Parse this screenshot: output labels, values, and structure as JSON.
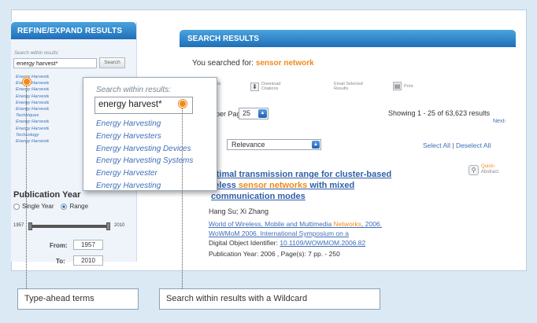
{
  "left_panel": {
    "header": "REFINE/EXPAND RESULTS",
    "search_label": "Search within results:",
    "search_value": "energy harvest*",
    "search_button": "Search",
    "list_items": [
      "Energy Harvesting",
      "Energy Harvesters",
      "Energy Harvesting",
      "Energy Harvesting",
      "Energy Harvesting",
      "Energy Harvesting",
      "Techniques",
      "Energy Harvesting",
      "Energy Harvesting",
      "Technology",
      "Energy Harvesting"
    ],
    "pub_year_title": "Publication Year",
    "radio_single": "Single Year",
    "radio_range": "Range",
    "slider_min": "1957",
    "slider_max": "2010",
    "from_label": "From:",
    "from_value": "1957",
    "to_label": "To:",
    "to_value": "2010"
  },
  "right_panel": {
    "header": "SEARCH RESULTS",
    "searched_prefix": "You searched for:",
    "searched_term": "sensor network",
    "tools": [
      {
        "icon": "email-icon",
        "line1": "This",
        "line2": "ch"
      },
      {
        "icon": "download-icon",
        "line1": "Download",
        "line2": "Citations"
      },
      {
        "icon": "email-selected-icon",
        "line1": "Email Selected",
        "line2": "Results"
      },
      {
        "icon": "print-icon",
        "line1": "Print",
        "line2": ""
      }
    ],
    "per_page_label": "per Page",
    "per_page_value": "25",
    "showing": "Showing 1 - 25 of 63,623 results",
    "next": "Next",
    "sort_value": "Relevance",
    "select_all": "Select All",
    "deselect_all": "Deselect All",
    "result": {
      "title_part1": "ptimal transmission range for cluster-based",
      "title_part2_pre": "reless ",
      "title_highlight": "sensor networks",
      "title_part2_post": " with mixed",
      "title_part3": "communication modes",
      "quick_line1": "Quick",
      "quick_line2": "Abstract",
      "authors": "Hang Su; Xi Zhang",
      "pub_line1_pre": "World of Wireless, Mobile and Multimedia ",
      "pub_line1_hl": "Networks",
      "pub_line1_post": ", 2006.",
      "pub_line2": "WoWMoM 2006. International Symposium on a",
      "doi_label": "Digital Object Identifier:",
      "doi_value": "10.1109/WOWMOM.2006.82",
      "pub_year": "Publication Year: 2006 , Page(s): 7 pp. - 250"
    }
  },
  "zoom_popup": {
    "label": "Search within results:",
    "value": "energy harvest*",
    "items": [
      "Energy Harvesting",
      "Energy Harvesters",
      "Energy Harvesting Devices",
      "Energy Harvesting Systems",
      "Energy Harvester",
      "Energy Harvesting"
    ]
  },
  "callouts": {
    "left": "Type-ahead terms",
    "right": "Search within results with a Wildcard"
  },
  "colors": {
    "accent_orange": "#f08a1d",
    "header_blue": "#1f6fb8",
    "link_blue": "#3f6fb8"
  }
}
